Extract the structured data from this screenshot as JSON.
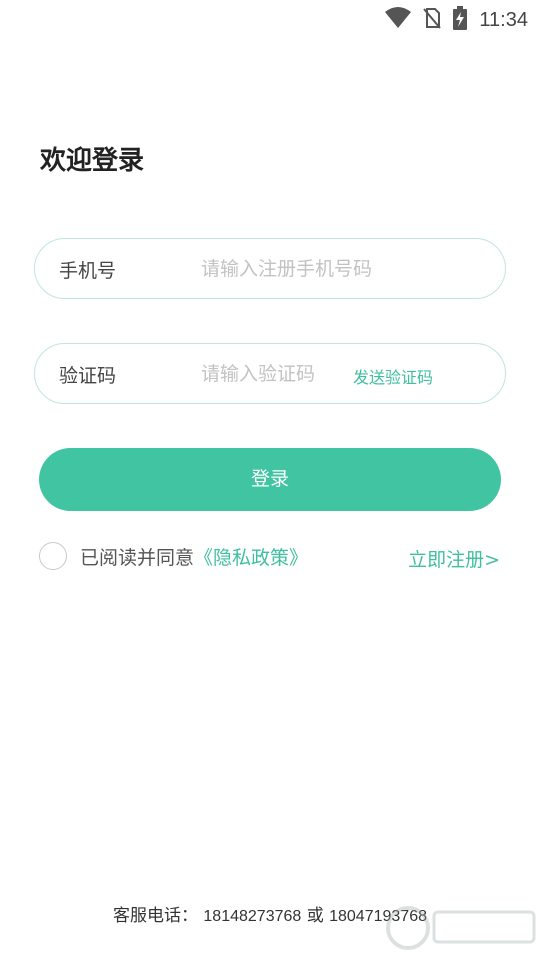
{
  "status_bar": {
    "time": "11:34",
    "icons": [
      "wifi-icon",
      "no-sim-icon",
      "battery-charging-icon"
    ]
  },
  "page_title": "欢迎登录",
  "phone_field": {
    "label": "手机号",
    "placeholder": "请输入注册手机号码",
    "value": ""
  },
  "code_field": {
    "label": "验证码",
    "placeholder": "请输入验证码",
    "value": "",
    "send_code_label": "发送验证码"
  },
  "login_button": "登录",
  "agreement": {
    "checked": false,
    "text": "已阅读并同意",
    "link": "《隐私政策》"
  },
  "register_link": "立即注册>",
  "footer": {
    "label": "客服电话：",
    "phone1": "18148273768",
    "or": "或",
    "phone2": "18047193768"
  },
  "colors": {
    "accent": "#41c4a2",
    "link": "#3fbf9f",
    "field_border": "#bfe6da"
  }
}
